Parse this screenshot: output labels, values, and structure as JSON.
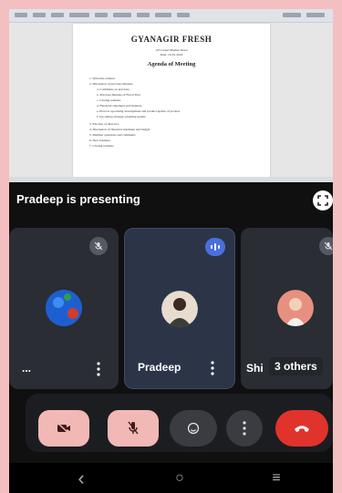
{
  "document": {
    "title": "GYANAGIR FRESH",
    "subtitle_lines": [
      "123 Grand Maidan Street",
      "Date: 10-01-2020"
    ],
    "heading": "Agenda of Meeting",
    "items": [
      "1. Welcome address",
      "2. Discussion of previous minutes",
      "a. Comments on previous",
      "b. Previous minutes of Fiscal Year",
      "c. Closing remarks",
      "d. Financial statement and business",
      "e. Plan for upcoming development and product update of product",
      "f. Upcoming strategic planning update",
      "3. Election of directors",
      "4. Discussion of financial statement and budget",
      "5. Member questions and comments",
      "6. New business",
      "7. Closing remarks"
    ]
  },
  "presenting": {
    "title": "Pradeep is presenting",
    "fullscreen_icon": "fullscreen-icon"
  },
  "participants": [
    {
      "name": "...",
      "status": "muted",
      "avatar_color": "#1e66d8"
    },
    {
      "name": "Pradeep",
      "status": "speaking",
      "avatar_color": "#e8d6c4"
    },
    {
      "name": "Shi",
      "status": "muted",
      "avatar_color": "#e89080"
    }
  ],
  "others_label": "3 others",
  "controls": {
    "camera": {
      "icon": "camera-off-icon",
      "color": "#f2b8b5"
    },
    "mic": {
      "icon": "mic-off-icon",
      "color": "#f2b8b5"
    },
    "reactions": {
      "icon": "emoji-icon"
    },
    "more": {
      "icon": "more-vert-icon"
    },
    "hangup": {
      "icon": "call-end-icon",
      "color": "#e0332c"
    }
  },
  "nav": {
    "back": "‹",
    "home": "○",
    "recents": "≡"
  }
}
